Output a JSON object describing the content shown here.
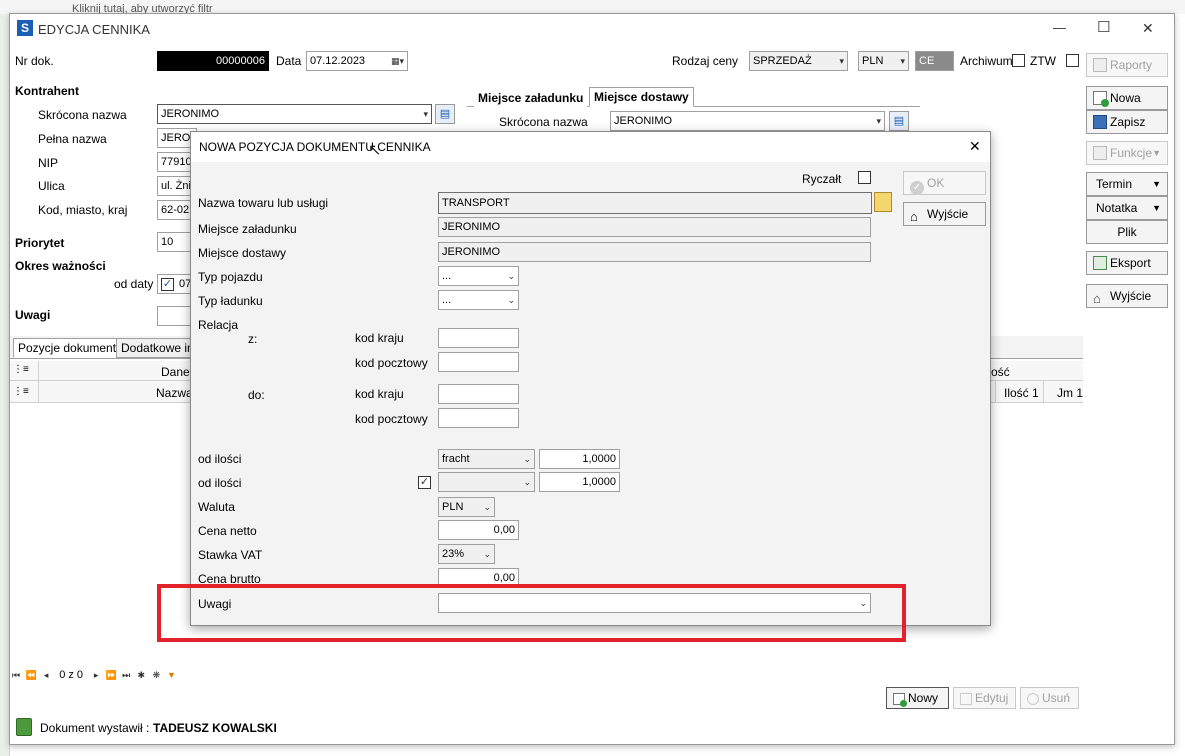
{
  "background_hint": "Kliknij tutaj, aby utworzyć filtr",
  "window": {
    "title": "EDYCJA CENNIKA",
    "min": "—",
    "max": "☐",
    "close": "✕"
  },
  "header": {
    "nrdok_label": "Nr dok.",
    "nrdok_value": "00000006",
    "data_label": "Data",
    "data_value": "07.12.2023",
    "rodzaj_label": "Rodzaj ceny",
    "rodzaj_value": "SPRZEDAŻ",
    "currency_value": "PLN",
    "ce_value": "CE",
    "archiwum_label": "Archiwum",
    "ztw_label": "ZTW"
  },
  "kontrahent": {
    "section": "Kontrahent",
    "skrocona_label": "Skrócona nazwa",
    "skrocona_value": "JERONIMO",
    "pelna_label": "Pełna nazwa",
    "pelna_value": "JERON",
    "nip_label": "NIP",
    "nip_value": "77910",
    "ulica_label": "Ulica",
    "ulica_value": "ul. Żni",
    "kod_label": "Kod, miasto, kraj",
    "kod_value": "62-02",
    "priorytet_label": "Priorytet",
    "priorytet_value": "10",
    "okres_label": "Okres ważności",
    "oddaty_label": "od daty",
    "oddaty_value": "07",
    "uwagi_label": "Uwagi"
  },
  "miejsce": {
    "tab1": "Miejsce załadunku",
    "tab2": "Miejsce dostawy",
    "skrocona_label": "Skrócona nazwa",
    "skrocona_value": "JERONIMO"
  },
  "right_panel": {
    "raporty": "Raporty",
    "nowa": "Nowa",
    "zapisz": "Zapisz",
    "funkcje": "Funkcje",
    "termin": "Termin",
    "notatka": "Notatka",
    "plik": "Plik",
    "eksport": "Eksport",
    "wyjscie": "Wyjście"
  },
  "bottom_tabs": {
    "tab1": "Pozycje dokumentu",
    "tab2": "Dodatkowe inf"
  },
  "grid": {
    "group_header": "Dane",
    "group_header_right": "ość",
    "col_nazwa": "Nazwa",
    "col_ilosc": "Ilość 1",
    "col_jm": "Jm 1"
  },
  "pager": {
    "count": "0 z 0"
  },
  "bottom_buttons": {
    "nowy": "Nowy",
    "edytuj": "Edytuj",
    "usun": "Usuń"
  },
  "status": {
    "label": "Dokument wystawił :",
    "value": "TADEUSZ KOWALSKI"
  },
  "dialog": {
    "title": "NOWA POZYCJA DOKUMENTU CENNIKA",
    "close": "✕",
    "ryczalt_label": "Ryczałt",
    "ok": "OK",
    "wyjscie": "Wyjście",
    "nazwa_label": "Nazwa towaru lub usługi",
    "nazwa_value": "TRANSPORT",
    "zaladunek_label": "Miejsce załadunku",
    "zaladunek_value": "JERONIMO",
    "dostawy_label": "Miejsce dostawy",
    "dostawy_value": "JERONIMO",
    "typpoj_label": "Typ pojazdu",
    "typpoj_value": "...",
    "typlad_label": "Typ ładunku",
    "typlad_value": "...",
    "relacja_label": "Relacja",
    "z_label": "z:",
    "do_label": "do:",
    "kodkraju_label": "kod kraju",
    "kodpocz_label": "kod pocztowy",
    "odilosci1_label": "od ilości",
    "odilosci1_combo": "fracht",
    "odilosci1_value": "1,0000",
    "odilosci2_label": "od ilości",
    "odilosci2_value": "1,0000",
    "waluta_label": "Waluta",
    "waluta_value": "PLN",
    "netto_label": "Cena netto",
    "netto_value": "0,00",
    "vat_label": "Stawka VAT",
    "vat_value": "23%",
    "brutto_label": "Cena brutto",
    "brutto_value": "0,00",
    "uwagi_label": "Uwagi",
    "uwagi_value": ""
  },
  "colors": {
    "highlight": "#e3222b",
    "accent": "#1a5fb4"
  }
}
